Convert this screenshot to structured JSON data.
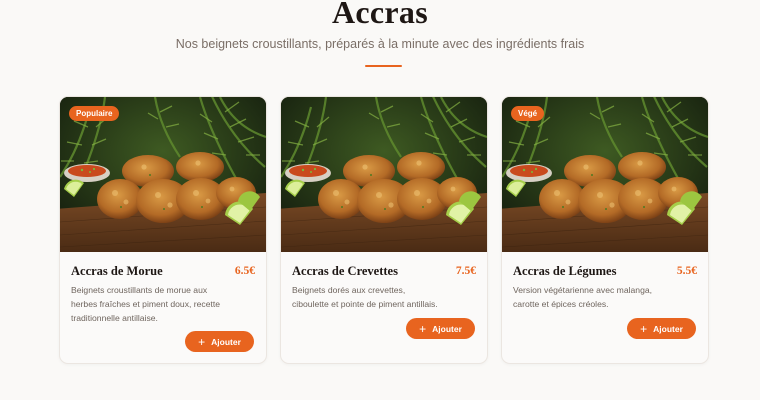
{
  "header": {
    "title": "Accras",
    "subtitle": "Nos beignets croustillants, préparés à la minute avec des ingrédients frais"
  },
  "colors": {
    "accent": "#e8641f",
    "background": "#faf9f7"
  },
  "cards": [
    {
      "badge": "Populaire",
      "name": "Accras de Morue",
      "price": "6.5€",
      "description": "Beignets croustillants de morue aux herbes fraîches et piment doux, recette traditionnelle antillaise.",
      "button_label": "Ajouter",
      "button_icon": "plus-icon"
    },
    {
      "badge": "",
      "name": "Accras de Crevettes",
      "price": "7.5€",
      "description": "Beignets dorés aux crevettes, ciboulette et pointe de piment antillais.",
      "button_label": "Ajouter",
      "button_icon": "plus-icon"
    },
    {
      "badge": "Végé",
      "name": "Accras de Légumes",
      "price": "5.5€",
      "description": "Version végétarienne avec malanga, carotte et épices créoles.",
      "button_label": "Ajouter",
      "button_icon": "plus-icon"
    }
  ]
}
